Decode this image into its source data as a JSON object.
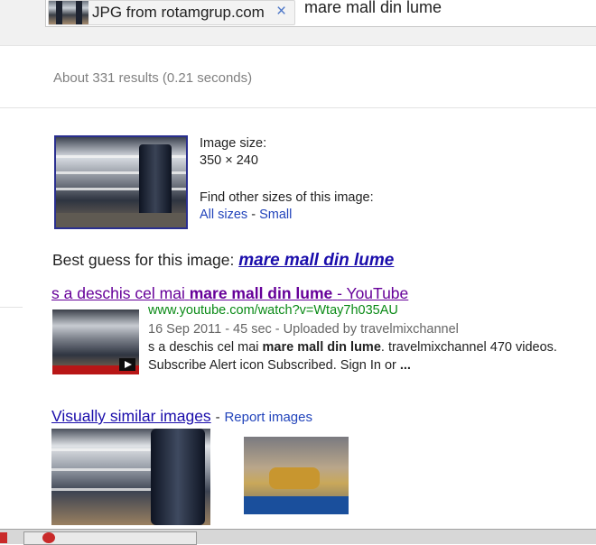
{
  "search": {
    "chip_label": "JPG from rotamgrup.com",
    "chip_close": "×",
    "query": "mare mall din lume"
  },
  "stats": "About 331 results (0.21 seconds)",
  "image_info": {
    "size_label": "Image size:",
    "size_value": "350 × 240",
    "find_label": "Find other sizes of this image:",
    "all_sizes": "All sizes",
    "separator": "-",
    "small": "Small"
  },
  "best_guess": {
    "label": "Best guess for this image:",
    "value": "mare mall din lume"
  },
  "result": {
    "title_prefix": "s a deschis cel mai",
    "title_bold": "mare mall din lume",
    "title_suffix": "- YouTube",
    "url": "www.youtube.com/watch?v=Wtay7h035AU",
    "meta": "16 Sep 2011 - 45 sec - Uploaded by travelmixchannel",
    "snippet_line1_prefix": "s a deschis cel mai",
    "snippet_line1_bold": "mare mall din lume",
    "snippet_line1_suffix": ". travelmixchannel 470 videos.",
    "snippet_line2": "Subscribe Alert icon Subscribed. Sign In or",
    "snippet_line2_bold": "..."
  },
  "similar": {
    "title": "Visually similar images",
    "separator": "-",
    "report": "Report images"
  }
}
